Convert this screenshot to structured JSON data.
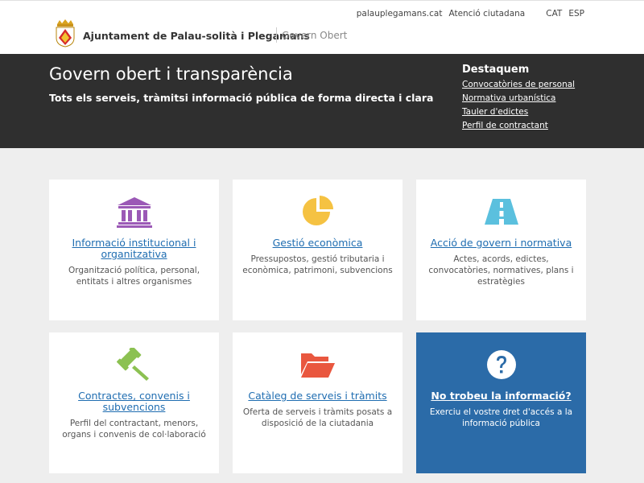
{
  "header": {
    "org_name": "Ajuntament de Palau-solità i Plegamans",
    "org_subtitle": "Govern Obert",
    "links": {
      "site": "palauplegamans.cat",
      "atencio": "Atenció ciutadana",
      "cat": "CAT",
      "esp": "ESP"
    }
  },
  "hero": {
    "title": "Govern obert i transparència",
    "subtitle": "Tots els serveis, tràmitsi informació pública de forma directa i clara",
    "destaquem": {
      "title": "Destaquem",
      "links": [
        "Convocatòries de personal",
        "Normativa urbanística",
        "Tauler d'edictes",
        "Perfil de contractant"
      ]
    }
  },
  "cards": [
    {
      "icon": "institution-building-icon",
      "title": "Informació institucional i organitzativa",
      "desc": "Organització política, personal, entitats i altres organismes",
      "color": "#9b59b6"
    },
    {
      "icon": "pie-chart-icon",
      "title": "Gestió econòmica",
      "desc": "Pressupostos, gestió tributaria i econòmica, patrimoni, subvencions",
      "color": "#f5c242"
    },
    {
      "icon": "road-icon",
      "title": "Acció de govern i normativa",
      "desc": "Actes, acords, edictes, convocatòries, normatives, plans i estratègies",
      "color": "#5bc0de"
    },
    {
      "icon": "gavel-icon",
      "title": "Contractes, convenis i subvencions",
      "desc": "Perfil del contractant, menors, organs i convenis de col·laboració",
      "color": "#8cc152"
    },
    {
      "icon": "folder-open-icon",
      "title": "Catàleg de serveis i tràmits",
      "desc": "Oferta de serveis i tràmits posats a disposició de la ciutadania",
      "color": "#e9573f"
    },
    {
      "icon": "question-circle-icon",
      "title": "No trobeu la informació?",
      "desc": "Exerciu el vostre dret d'accés a la informació pública",
      "color": "#ffffff"
    }
  ]
}
